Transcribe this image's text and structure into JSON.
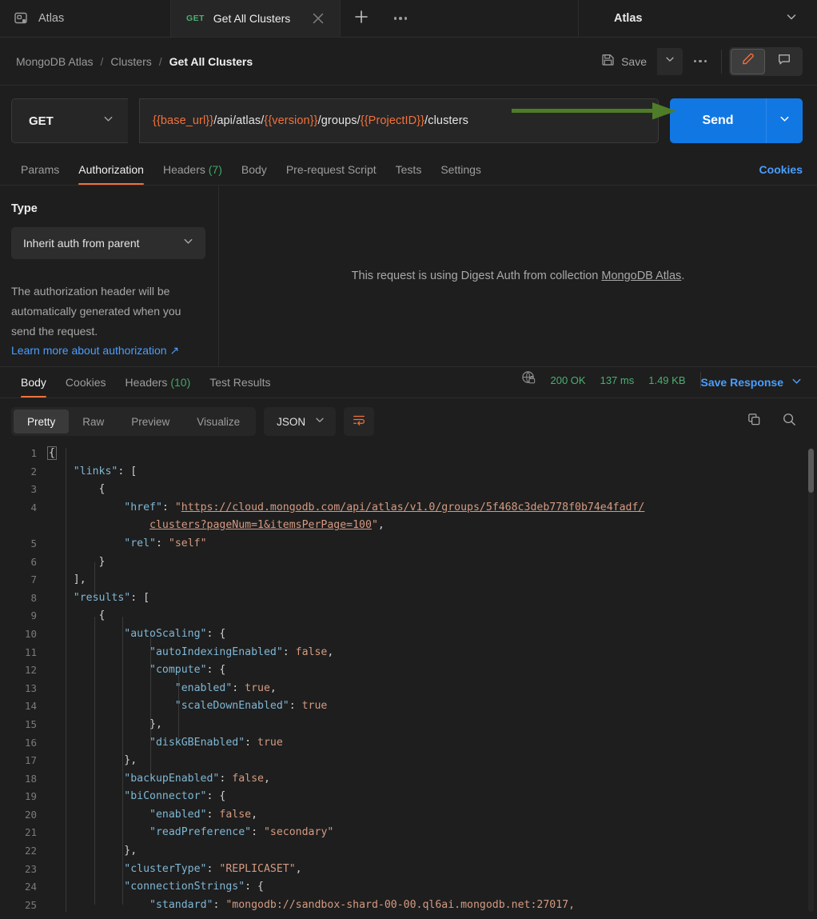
{
  "topbar": {
    "app_icon": "postman-workspace-icon",
    "app_label": "Atlas",
    "request_tab": {
      "method": "GET",
      "name": "Get All Clusters",
      "close_icon": "close-icon"
    },
    "new_tab_icon": "plus-icon",
    "tab_more_icon": "ellipsis-icon",
    "environment": {
      "name": "Atlas",
      "caret_icon": "chevron-down-icon"
    }
  },
  "breadcrumb": {
    "items": [
      "MongoDB Atlas",
      "Clusters",
      "Get All Clusters"
    ],
    "separator": "/"
  },
  "actions": {
    "save_label": "Save",
    "save_icon": "floppy-disk-icon",
    "save_caret_icon": "chevron-down-icon",
    "more_icon": "ellipsis-icon",
    "edit_icon": "pencil-icon",
    "comment_icon": "comment-icon",
    "accent_orange": "#f2713b"
  },
  "url_bar": {
    "method": "GET",
    "method_caret_icon": "chevron-down-icon",
    "url_segments": [
      {
        "text": "{{base_url}}",
        "variable": true
      },
      {
        "text": "/api/atlas/",
        "variable": false
      },
      {
        "text": "{{version}}",
        "variable": true
      },
      {
        "text": "/groups/",
        "variable": false
      },
      {
        "text": "{{ProjectID}}",
        "variable": true
      },
      {
        "text": "/clusters",
        "variable": false
      }
    ],
    "url_full": "{{base_url}}/api/atlas/{{version}}/groups/{{ProjectID}}/clusters",
    "send_label": "Send",
    "send_caret_icon": "chevron-down-icon",
    "send_color": "#1178e3",
    "annotation_arrow_color": "#4f7c28"
  },
  "request_tabs": {
    "items": [
      {
        "label": "Params",
        "count": "",
        "active": false
      },
      {
        "label": "Authorization",
        "count": "",
        "active": true
      },
      {
        "label": "Headers",
        "count": "(7)",
        "active": false
      },
      {
        "label": "Body",
        "count": "",
        "active": false
      },
      {
        "label": "Pre-request Script",
        "count": "",
        "active": false
      },
      {
        "label": "Tests",
        "count": "",
        "active": false
      },
      {
        "label": "Settings",
        "count": "",
        "active": false
      }
    ],
    "cookies_label": "Cookies"
  },
  "auth": {
    "type_label": "Type",
    "type_value": "Inherit auth from parent",
    "type_caret_icon": "chevron-down-icon",
    "description": "The authorization header will be automatically generated when you send the request.",
    "learn_more": "Learn more about authorization ↗",
    "notice_prefix": "This request is using Digest Auth from collection ",
    "notice_link": "MongoDB Atlas",
    "notice_suffix": "."
  },
  "response": {
    "tabs": [
      {
        "label": "Body",
        "count": "",
        "active": true
      },
      {
        "label": "Cookies",
        "count": "",
        "active": false
      },
      {
        "label": "Headers",
        "count": "(10)",
        "active": false
      },
      {
        "label": "Test Results",
        "count": "",
        "active": false
      }
    ],
    "network_icon": "globe-lock-icon",
    "status": "200 OK",
    "time": "137 ms",
    "size": "1.49 KB",
    "save_response_label": "Save Response",
    "save_response_caret_icon": "chevron-down-icon",
    "view_modes": [
      {
        "label": "Pretty",
        "active": true
      },
      {
        "label": "Raw",
        "active": false
      },
      {
        "label": "Preview",
        "active": false
      },
      {
        "label": "Visualize",
        "active": false
      }
    ],
    "format": "JSON",
    "format_caret_icon": "chevron-down-icon",
    "wrap_icon": "word-wrap-icon",
    "copy_icon": "copy-icon",
    "search_icon": "search-icon"
  },
  "body_json": {
    "lines": [
      {
        "n": "1",
        "indent": 0,
        "tokens": [
          {
            "t": "{",
            "c": "fold"
          }
        ]
      },
      {
        "n": "2",
        "indent": 1,
        "tokens": [
          {
            "t": "\"links\"",
            "c": "k"
          },
          {
            "t": ": [",
            "c": "p"
          }
        ]
      },
      {
        "n": "3",
        "indent": 2,
        "tokens": [
          {
            "t": "{",
            "c": "p"
          }
        ]
      },
      {
        "n": "4",
        "indent": 3,
        "tokens": [
          {
            "t": "\"href\"",
            "c": "k"
          },
          {
            "t": ": ",
            "c": "p"
          },
          {
            "t": "\"",
            "c": "s"
          },
          {
            "t": "https://cloud.mongodb.com/api/atlas/v1.0/groups/5f468c3deb778f0b74e4fadf/",
            "c": "s u"
          }
        ]
      },
      {
        "n": "",
        "indent": 4,
        "tokens": [
          {
            "t": "clusters?pageNum=1&itemsPerPage=100",
            "c": "s u"
          },
          {
            "t": "\"",
            "c": "s"
          },
          {
            "t": ",",
            "c": "p"
          }
        ],
        "cont": true
      },
      {
        "n": "5",
        "indent": 3,
        "tokens": [
          {
            "t": "\"rel\"",
            "c": "k"
          },
          {
            "t": ": ",
            "c": "p"
          },
          {
            "t": "\"self\"",
            "c": "s"
          }
        ]
      },
      {
        "n": "6",
        "indent": 2,
        "tokens": [
          {
            "t": "}",
            "c": "p"
          }
        ]
      },
      {
        "n": "7",
        "indent": 1,
        "tokens": [
          {
            "t": "],",
            "c": "p"
          }
        ]
      },
      {
        "n": "8",
        "indent": 1,
        "tokens": [
          {
            "t": "\"results\"",
            "c": "k"
          },
          {
            "t": ": [",
            "c": "p"
          }
        ]
      },
      {
        "n": "9",
        "indent": 2,
        "tokens": [
          {
            "t": "{",
            "c": "p"
          }
        ]
      },
      {
        "n": "10",
        "indent": 3,
        "tokens": [
          {
            "t": "\"autoScaling\"",
            "c": "k"
          },
          {
            "t": ": {",
            "c": "p"
          }
        ]
      },
      {
        "n": "11",
        "indent": 4,
        "tokens": [
          {
            "t": "\"autoIndexingEnabled\"",
            "c": "k"
          },
          {
            "t": ": ",
            "c": "p"
          },
          {
            "t": "false",
            "c": "s"
          },
          {
            "t": ",",
            "c": "p"
          }
        ]
      },
      {
        "n": "12",
        "indent": 4,
        "tokens": [
          {
            "t": "\"compute\"",
            "c": "k"
          },
          {
            "t": ": {",
            "c": "p"
          }
        ]
      },
      {
        "n": "13",
        "indent": 5,
        "tokens": [
          {
            "t": "\"enabled\"",
            "c": "k"
          },
          {
            "t": ": ",
            "c": "p"
          },
          {
            "t": "true",
            "c": "s"
          },
          {
            "t": ",",
            "c": "p"
          }
        ]
      },
      {
        "n": "14",
        "indent": 5,
        "tokens": [
          {
            "t": "\"scaleDownEnabled\"",
            "c": "k"
          },
          {
            "t": ": ",
            "c": "p"
          },
          {
            "t": "true",
            "c": "s"
          }
        ]
      },
      {
        "n": "15",
        "indent": 4,
        "tokens": [
          {
            "t": "},",
            "c": "p"
          }
        ]
      },
      {
        "n": "16",
        "indent": 4,
        "tokens": [
          {
            "t": "\"diskGBEnabled\"",
            "c": "k"
          },
          {
            "t": ": ",
            "c": "p"
          },
          {
            "t": "true",
            "c": "s"
          }
        ]
      },
      {
        "n": "17",
        "indent": 3,
        "tokens": [
          {
            "t": "},",
            "c": "p"
          }
        ]
      },
      {
        "n": "18",
        "indent": 3,
        "tokens": [
          {
            "t": "\"backupEnabled\"",
            "c": "k"
          },
          {
            "t": ": ",
            "c": "p"
          },
          {
            "t": "false",
            "c": "s"
          },
          {
            "t": ",",
            "c": "p"
          }
        ]
      },
      {
        "n": "19",
        "indent": 3,
        "tokens": [
          {
            "t": "\"biConnector\"",
            "c": "k"
          },
          {
            "t": ": {",
            "c": "p"
          }
        ]
      },
      {
        "n": "20",
        "indent": 4,
        "tokens": [
          {
            "t": "\"enabled\"",
            "c": "k"
          },
          {
            "t": ": ",
            "c": "p"
          },
          {
            "t": "false",
            "c": "s"
          },
          {
            "t": ",",
            "c": "p"
          }
        ]
      },
      {
        "n": "21",
        "indent": 4,
        "tokens": [
          {
            "t": "\"readPreference\"",
            "c": "k"
          },
          {
            "t": ": ",
            "c": "p"
          },
          {
            "t": "\"secondary\"",
            "c": "s"
          }
        ]
      },
      {
        "n": "22",
        "indent": 3,
        "tokens": [
          {
            "t": "},",
            "c": "p"
          }
        ]
      },
      {
        "n": "23",
        "indent": 3,
        "tokens": [
          {
            "t": "\"clusterType\"",
            "c": "k"
          },
          {
            "t": ": ",
            "c": "p"
          },
          {
            "t": "\"REPLICASET\"",
            "c": "s"
          },
          {
            "t": ",",
            "c": "p"
          }
        ]
      },
      {
        "n": "24",
        "indent": 3,
        "tokens": [
          {
            "t": "\"connectionStrings\"",
            "c": "k"
          },
          {
            "t": ": {",
            "c": "p"
          }
        ]
      },
      {
        "n": "25",
        "indent": 4,
        "tokens": [
          {
            "t": "\"standard\"",
            "c": "k"
          },
          {
            "t": ": ",
            "c": "p"
          },
          {
            "t": "\"mongodb://sandbox-shard-00-00.ql6ai.mongodb.net:27017,",
            "c": "s"
          }
        ]
      }
    ]
  }
}
